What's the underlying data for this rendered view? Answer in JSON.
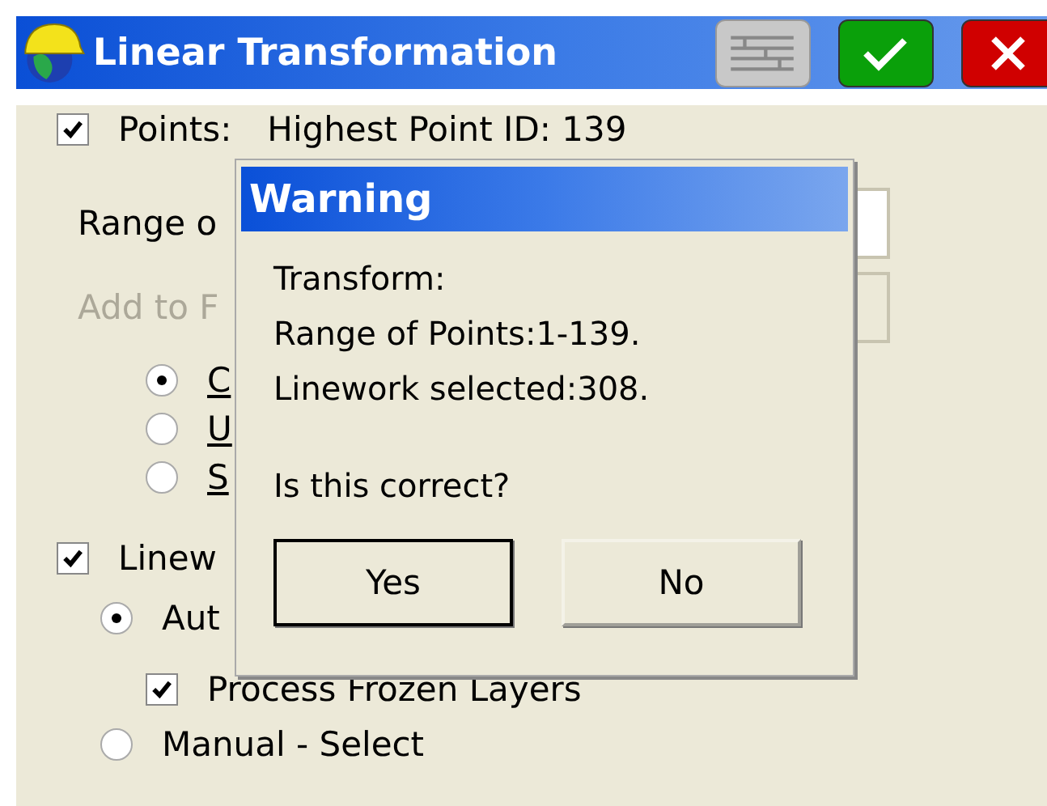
{
  "window": {
    "title": "Linear Transformation"
  },
  "points": {
    "checked": true,
    "label": "Points:",
    "info": "Highest Point ID:  139"
  },
  "range": {
    "label": "Range o"
  },
  "add_to": {
    "label": "Add to F",
    "disabled": true
  },
  "options": [
    {
      "label": "C",
      "selected": true
    },
    {
      "label": "U",
      "selected": false
    },
    {
      "label": "S",
      "selected": false
    }
  ],
  "linework": {
    "checked": true,
    "label": "Linew"
  },
  "linework_options": [
    {
      "kind": "radio",
      "label": "Aut",
      "selected": true
    },
    {
      "kind": "checkbox",
      "label": "Process Frozen Layers",
      "checked": true
    },
    {
      "kind": "radio",
      "label": "Manual - Select",
      "selected": false
    }
  ],
  "dialog": {
    "title": "Warning",
    "message": [
      "Transform:",
      "Range of Points:1-139.",
      "Linework selected:308."
    ],
    "question": "Is this correct?",
    "buttons": [
      {
        "label": "Yes",
        "default": true
      },
      {
        "label": "No",
        "default": false
      }
    ]
  }
}
